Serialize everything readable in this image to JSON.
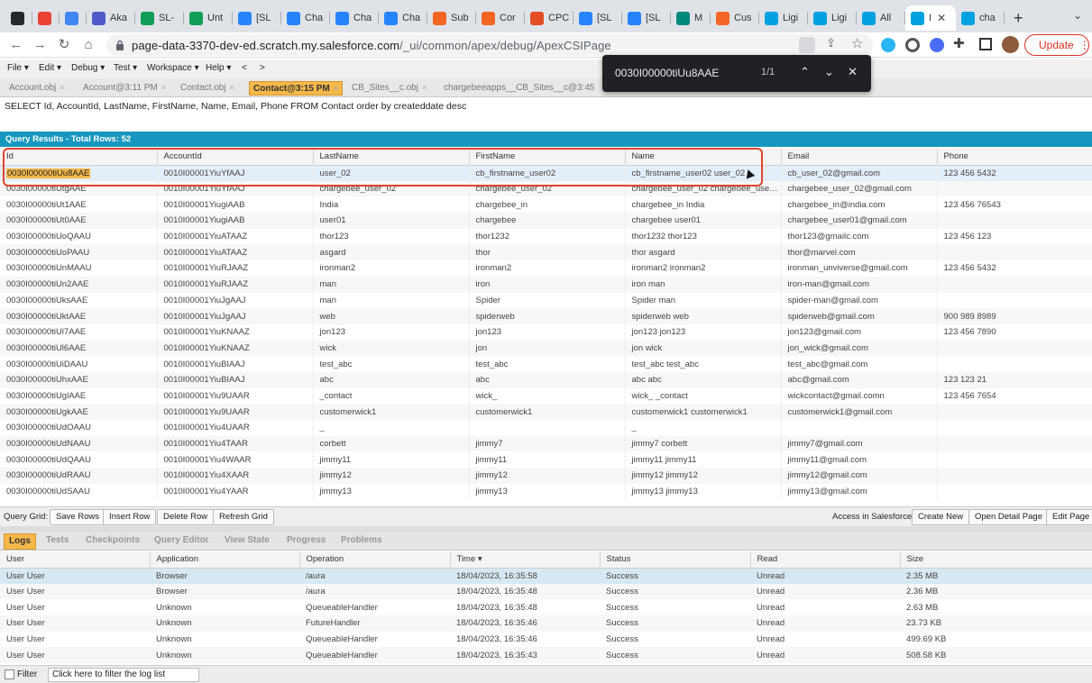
{
  "browser": {
    "tabs": [
      {
        "label": "",
        "icon": "github-icon",
        "color": "#24292e"
      },
      {
        "label": "",
        "icon": "gmail-icon",
        "color": "#ea4335"
      },
      {
        "label": "",
        "icon": "translate-icon",
        "color": "#4285f4"
      },
      {
        "label": "Aka",
        "icon": "teams-icon",
        "color": "#5059c9"
      },
      {
        "label": "SL-",
        "icon": "sheets-icon",
        "color": "#0f9d58"
      },
      {
        "label": "Unt",
        "icon": "sheets-icon",
        "color": "#0f9d58"
      },
      {
        "label": "[SL",
        "icon": "jira-icon",
        "color": "#2684ff"
      },
      {
        "label": "Cha",
        "icon": "confluence-icon",
        "color": "#2684ff"
      },
      {
        "label": "Cha",
        "icon": "confluence-icon",
        "color": "#2684ff"
      },
      {
        "label": "Cha",
        "icon": "confluence-icon",
        "color": "#2684ff"
      },
      {
        "label": "Sub",
        "icon": "chargebee-icon",
        "color": "#f26522"
      },
      {
        "label": "Cor",
        "icon": "chargebee-icon",
        "color": "#f26522"
      },
      {
        "label": "CPC",
        "icon": "figma-icon",
        "color": "#e34d26"
      },
      {
        "label": "[SL",
        "icon": "jira-icon",
        "color": "#2684ff"
      },
      {
        "label": "[SL",
        "icon": "jira-icon",
        "color": "#2684ff"
      },
      {
        "label": "M",
        "icon": "meet-icon",
        "color": "#00897b"
      },
      {
        "label": "Cus",
        "icon": "chargebee-icon",
        "color": "#f26522"
      },
      {
        "label": "Ligi",
        "icon": "salesforce-icon",
        "color": "#00a1e0"
      },
      {
        "label": "Ligi",
        "icon": "salesforce-icon",
        "color": "#00a1e0"
      },
      {
        "label": "All",
        "icon": "salesforce-icon",
        "color": "#00a1e0"
      },
      {
        "label": "I",
        "icon": "salesforce-icon",
        "color": "#00a1e0"
      },
      {
        "label": "cha",
        "icon": "salesforce-icon",
        "color": "#00a1e0"
      }
    ],
    "url_host": "page-data-3370-dev-ed.scratch.my.salesforce.com",
    "url_path": "/_ui/common/apex/debug/ApexCSIPage",
    "update_label": "Update",
    "find": {
      "query": "0030I00000tiUu8AAE",
      "count": "1/1",
      "up": "^",
      "down": "v",
      "close": "✕"
    }
  },
  "menu": [
    "File ▾",
    "Edit ▾",
    "Debug ▾",
    "Test ▾",
    "Workspace ▾",
    "Help ▾",
    "<",
    ">"
  ],
  "file_tabs": [
    "Account.obj",
    "Account@3:11 PM",
    "Contact.obj",
    "Contact@3:15 PM",
    "CB_Sites__c.obj",
    "chargebeeapps__CB_Sites__c@3:45"
  ],
  "query": "SELECT Id, AccountId, LastName, FirstName, Name, Email, Phone FROM Contact order by createddate desc",
  "results": {
    "header": "Query Results - Total Rows: 52",
    "columns": [
      "Id",
      "AccountId",
      "LastName",
      "FirstName",
      "Name",
      "Email",
      "Phone"
    ],
    "rows": [
      [
        "0030I00000tiUu8AAE",
        "0010I00001YiuYfAAJ",
        "user_02",
        "cb_firstname_user02",
        "cb_firstname_user02 user_02",
        "cb_user_02@gmail.com",
        "123 456 5432"
      ],
      [
        "0030I00000tiUtgAAE",
        "0010I00001YiuYfAAJ",
        "chargebee_user_02",
        "chargebee_user_02",
        "chargebee_user_02 chargebee_user_02",
        "chargebee_user_02@gmail.com",
        ""
      ],
      [
        "0030I00000tiUt1AAE",
        "0010I00001YiugiAAB",
        "India",
        "chargebee_in",
        "chargebee_in India",
        "chargebee_in@india.com",
        "123 456 76543"
      ],
      [
        "0030I00000tiUt0AAE",
        "0010I00001YiugiAAB",
        "user01",
        "chargebee",
        "chargebee user01",
        "chargebee_user01@gmail.com",
        ""
      ],
      [
        "0030I00000tiUoQAAU",
        "0010I00001YiuATAAZ",
        "thor123",
        "thor1232",
        "thor1232 thor123",
        "thor123@gmailc.com",
        "123 456 123"
      ],
      [
        "0030I00000tiUoPAAU",
        "0010I00001YiuATAAZ",
        "asgard",
        "thor",
        "thor asgard",
        "thor@marvel.com",
        ""
      ],
      [
        "0030I00000tiUnMAAU",
        "0010I00001YiuRJAAZ",
        "ironman2",
        "ironman2",
        "ironman2 ironman2",
        "ironman_unviverse@gmail.com",
        "123 456 5432"
      ],
      [
        "0030I00000tiUn2AAE",
        "0010I00001YiuRJAAZ",
        "man",
        "iron",
        "iron man",
        "iron-man@gmail.com",
        ""
      ],
      [
        "0030I00000tiUksAAE",
        "0010I00001YiuJgAAJ",
        "man",
        "Spider",
        "Spider man",
        "spider-man@gmail.com",
        ""
      ],
      [
        "0030I00000tiUktAAE",
        "0010I00001YiuJgAAJ",
        "web",
        "spiderweb",
        "spiderweb web",
        "spiderweb@gmail.com",
        "900 989 8989"
      ],
      [
        "0030I00000tiUl7AAE",
        "0010I00001YiuKNAAZ",
        "jon123",
        "jon123",
        "jon123 jon123",
        "jon123@gmail.com",
        "123 456 7890"
      ],
      [
        "0030I00000tiUl6AAE",
        "0010I00001YiuKNAAZ",
        "wick",
        "jon",
        "jon wick",
        "jon_wick@gmail.com",
        ""
      ],
      [
        "0030I00000tiUiDAAU",
        "0010I00001YiuBIAAJ",
        "test_abc",
        "test_abc",
        "test_abc test_abc",
        "test_abc@gmail.com",
        ""
      ],
      [
        "0030I00000tiUhxAAE",
        "0010I00001YiuBIAAJ",
        "abc",
        "abc",
        "abc abc",
        "abc@gmail.com",
        "123 123 21"
      ],
      [
        "0030I00000tiUglAAE",
        "0010I00001Yiu9UAAR",
        "_contact",
        "wick_",
        "wick_ _contact",
        "wickcontact@gmail.comn",
        "123 456 7654"
      ],
      [
        "0030I00000tiUgkAAE",
        "0010I00001Yiu9UAAR",
        "customerwick1",
        "customerwick1",
        "customerwick1 customerwick1",
        "customerwick1@gmail.com",
        ""
      ],
      [
        "0030I00000tiUdOAAU",
        "0010I00001Yiu4UAAR",
        "_",
        "",
        "_",
        "",
        ""
      ],
      [
        "0030I00000tiUdNAAU",
        "0010I00001Yiu4TAAR",
        "corbett",
        "jimmy7",
        "jimmy7 corbett",
        "jimmy7@gmail.com",
        ""
      ],
      [
        "0030I00000tiUdQAAU",
        "0010I00001Yiu4WAAR",
        "jimmy11",
        "jimmy11",
        "jimmy11 jimmy11",
        "jimmy11@gmail.com",
        ""
      ],
      [
        "0030I00000tiUdRAAU",
        "0010I00001Yiu4XAAR",
        "jimmy12",
        "jimmy12",
        "jimmy12 jimmy12",
        "jimmy12@gmail.com",
        ""
      ],
      [
        "0030I00000tiUdSAAU",
        "0010I00001Yiu4YAAR",
        "jimmy13",
        "jimmy13",
        "jimmy13 jimmy13",
        "jimmy13@gmail.com",
        ""
      ]
    ]
  },
  "grid_toolbar": {
    "label": "Query Grid:",
    "left_buttons": [
      "Save Rows",
      "Insert Row",
      "Delete Row",
      "Refresh Grid"
    ],
    "right_label": "Access in Salesforce:",
    "right_buttons": [
      "Create New",
      "Open Detail Page",
      "Edit Page"
    ]
  },
  "log_tabs": [
    "Logs",
    "Tests",
    "Checkpoints",
    "Query Editor",
    "View State",
    "Progress",
    "Problems"
  ],
  "logs": {
    "columns": [
      "User",
      "Application",
      "Operation",
      "Time ▾",
      "Status",
      "Read",
      "Size"
    ],
    "rows": [
      [
        "User User",
        "Browser",
        "/aura",
        "18/04/2023, 16:35:58",
        "Success",
        "Unread",
        "2.35 MB"
      ],
      [
        "User User",
        "Browser",
        "/aura",
        "18/04/2023, 16:35:48",
        "Success",
        "Unread",
        "2.36 MB"
      ],
      [
        "User User",
        "Unknown",
        "QueueableHandler",
        "18/04/2023, 16:35:48",
        "Success",
        "Unread",
        "2.63 MB"
      ],
      [
        "User User",
        "Unknown",
        "FutureHandler",
        "18/04/2023, 16:35:46",
        "Success",
        "Unread",
        "23.73 KB"
      ],
      [
        "User User",
        "Unknown",
        "QueueableHandler",
        "18/04/2023, 16:35:46",
        "Success",
        "Unread",
        "499.69 KB"
      ],
      [
        "User User",
        "Unknown",
        "QueueableHandler",
        "18/04/2023, 16:35:43",
        "Success",
        "Unread",
        "508.58 KB"
      ]
    ]
  },
  "filter": {
    "label": "Filter",
    "placeholder": "Click here to filter the log list"
  },
  "colors": {
    "accent": "#f5b84a",
    "results_header": "#1797c0",
    "annotation": "#e0442e"
  }
}
